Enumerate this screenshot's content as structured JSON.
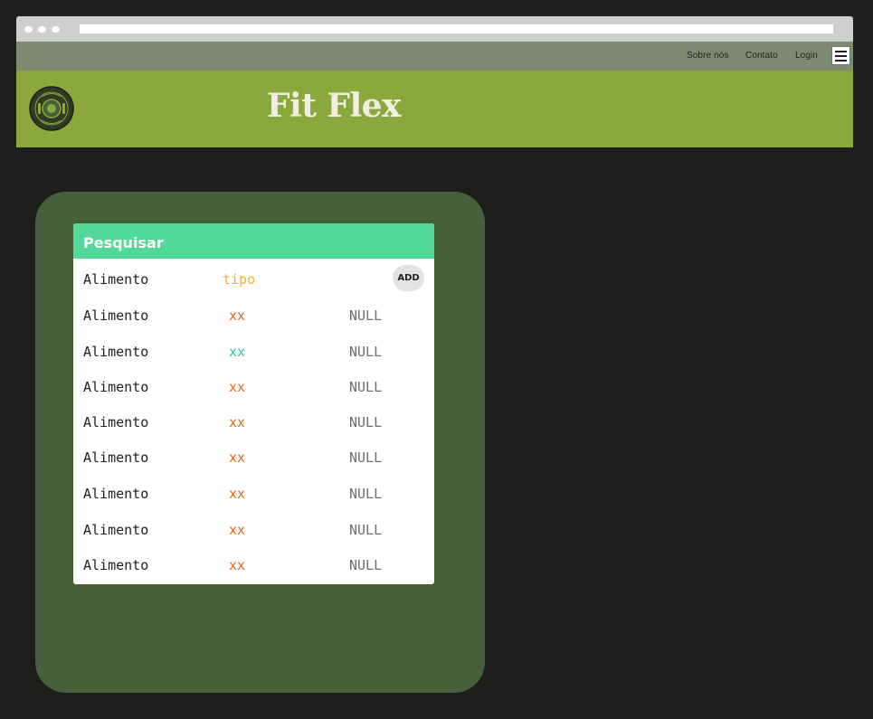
{
  "nav": {
    "links": [
      "Sobre nós",
      "Contato",
      "Login"
    ]
  },
  "header": {
    "title": "Fit Flex",
    "logo_icon": "fit-flex-plate-logo-icon"
  },
  "search": {
    "label": "Pesquisar"
  },
  "table": {
    "header_row": {
      "name": "Alimento",
      "type": "tipo",
      "button": "ADD"
    },
    "rows": [
      {
        "name": "Alimento",
        "type": "xx",
        "value": "NULL",
        "type_color": "#e06a1f"
      },
      {
        "name": "Alimento",
        "type": "xx",
        "value": "NULL",
        "type_color": "#2fc79a"
      },
      {
        "name": "Alimento",
        "type": "xx",
        "value": "NULL",
        "type_color": "#e06a1f"
      },
      {
        "name": "Alimento",
        "type": "xx",
        "value": "NULL",
        "type_color": "#e06a1f"
      },
      {
        "name": "Alimento",
        "type": "xx",
        "value": "NULL",
        "type_color": "#e06a1f"
      },
      {
        "name": "Alimento",
        "type": "xx",
        "value": "NULL",
        "type_color": "#e06a1f"
      },
      {
        "name": "Alimento",
        "type": "xx",
        "value": "NULL",
        "type_color": "#e06a1f"
      },
      {
        "name": "Alimento",
        "type": "xx",
        "value": "NULL",
        "type_color": "#e06a1f"
      }
    ]
  },
  "colors": {
    "background": "#1e1f1d",
    "topnav": "#7d8c71",
    "header": "#89a93c",
    "panel": "#46603a",
    "search_bar": "#52d99a",
    "tipo_label": "#e8b82e",
    "type_orange": "#e06a1f",
    "type_teal": "#2fc79a"
  }
}
